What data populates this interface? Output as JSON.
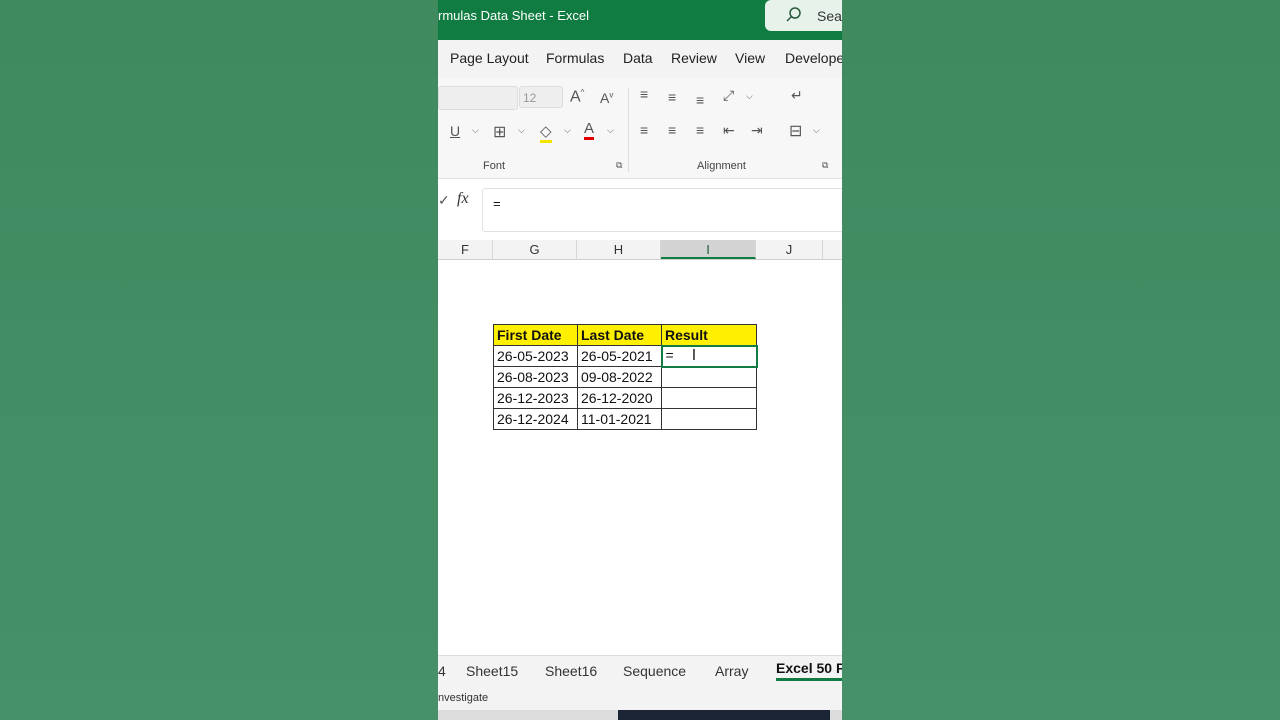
{
  "window": {
    "title": "rmulas Data Sheet  -  Excel"
  },
  "search": {
    "label": "Sear"
  },
  "ribbon_tabs": [
    "Page Layout",
    "Formulas",
    "Data",
    "Review",
    "View",
    "Develope"
  ],
  "ribbon": {
    "font_size": "12",
    "font_group_label": "Font",
    "alignment_group_label": "Alignment"
  },
  "formula_bar": {
    "fx_label": "fx",
    "value": "="
  },
  "columns": [
    "F",
    "G",
    "H",
    "I",
    "J"
  ],
  "selected_column": "I",
  "table": {
    "headers": [
      "First Date",
      "Last Date",
      "Result"
    ],
    "rows": [
      [
        "26-05-2023",
        "26-05-2021",
        "="
      ],
      [
        "26-08-2023",
        "09-08-2022",
        ""
      ],
      [
        "26-12-2023",
        "26-12-2020",
        ""
      ],
      [
        "26-12-2024",
        "11-01-2021",
        ""
      ]
    ]
  },
  "sheet_tabs": [
    "4",
    "Sheet15",
    "Sheet16",
    "Sequence",
    "Array",
    "Excel 50 F"
  ],
  "active_sheet": "Excel 50 F",
  "status_bar": {
    "text": "nvestigate"
  },
  "colors": {
    "excel_green": "#107c41",
    "header_fill": "#ffef00",
    "background": "#448a62"
  }
}
